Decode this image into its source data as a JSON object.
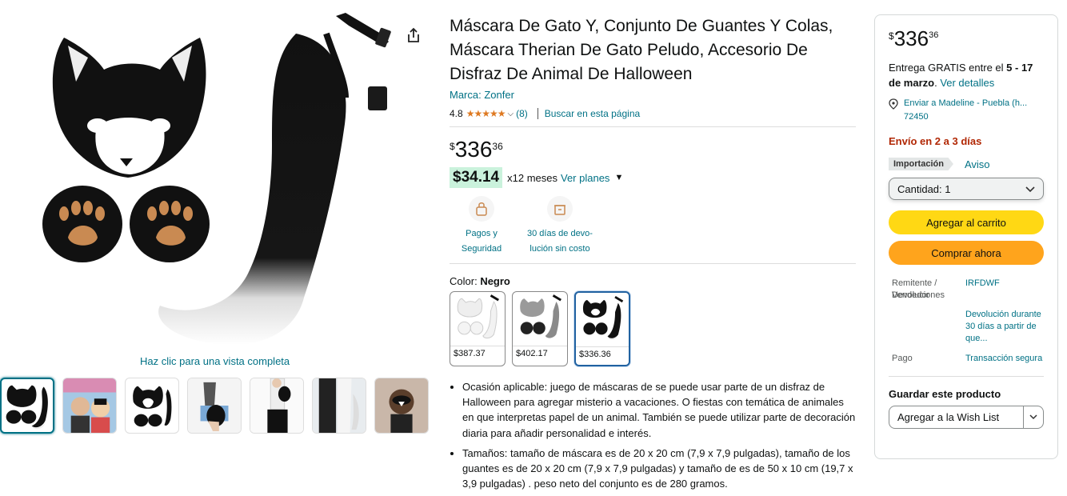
{
  "gallery": {
    "full_view_text": "Haz clic para una vista completa",
    "thumb_count": 7
  },
  "product": {
    "title": "Máscara De Gato Y, Conjunto De Guantes Y Colas, Máscara Therian De Gato Peludo, Accesorio De Disfraz De Animal De Halloween",
    "brand": "Marca: Zonfer",
    "rating": "4.8",
    "stars": "★★★★★",
    "reviews": "(8)",
    "search_page": "Buscar en esta página",
    "price_symbol": "$",
    "price_whole": "336",
    "price_fraction": "36",
    "installment_amount": "$34.14",
    "installment_text": "x12 meses",
    "installment_link": "Ver planes",
    "features": [
      {
        "line1": "Pagos y",
        "line2": "Seguridad"
      },
      {
        "line1": "30 días de devo-",
        "line2": "lución sin costo"
      }
    ],
    "color_label": "Color:",
    "color_value": "Negro",
    "swatches": [
      {
        "price": "$387.37"
      },
      {
        "price": "$402.17"
      },
      {
        "price": "$336.36"
      }
    ],
    "bullets": [
      "Ocasión aplicable: juego de máscaras de se puede usar parte de un disfraz de Halloween para agregar misterio a vacaciones. O fiestas con temática de animales en que interpretas papel de un animal. También se puede utilizar parte de decoración diaria para añadir personalidad e interés.",
      "Tamaños: tamaño de máscara es de 20 x 20 cm (7,9 x 7,9 pulgadas), tamaño de los guantes es de 20 x 20 cm (7,9 x 7,9 pulgadas) y tamaño de es de 50 x 10 cm (19,7 x 3,9 pulgadas) . peso neto del conjunto es de 280 gramos."
    ]
  },
  "buybox": {
    "price_symbol": "$",
    "price_whole": "336",
    "price_fraction": "36",
    "delivery_prefix": "Entrega GRATIS entre el",
    "delivery_dates": "5 - 17 de marzo",
    "delivery_link": "Ver detalles",
    "ship_to": "Enviar a Madeline - Puebla (h... 72450",
    "fast_ship": "Envío en 2 a 3 días",
    "import_badge": "Importación",
    "import_notice": "Aviso",
    "qty_label": "Cantidad:",
    "qty_value": "1",
    "add_to_cart": "Agregar al carrito",
    "buy_now": "Comprar ahora",
    "seller_label": "Remitente / Vendedor",
    "seller_value": "IRFDWF",
    "returns_label": "Devoluciones",
    "returns_value": "Devolución durante 30 días a partir de que...",
    "payment_label": "Pago",
    "payment_value": "Transacción segura",
    "save_title": "Guardar este producto",
    "wishlist": "Agregar a la Wish List"
  },
  "colors": {
    "link": "#007185",
    "cart_button": "#ffd814",
    "buy_button": "#ffa41c",
    "deal_bg": "#caf2dc",
    "fast_ship": "#b12704"
  }
}
